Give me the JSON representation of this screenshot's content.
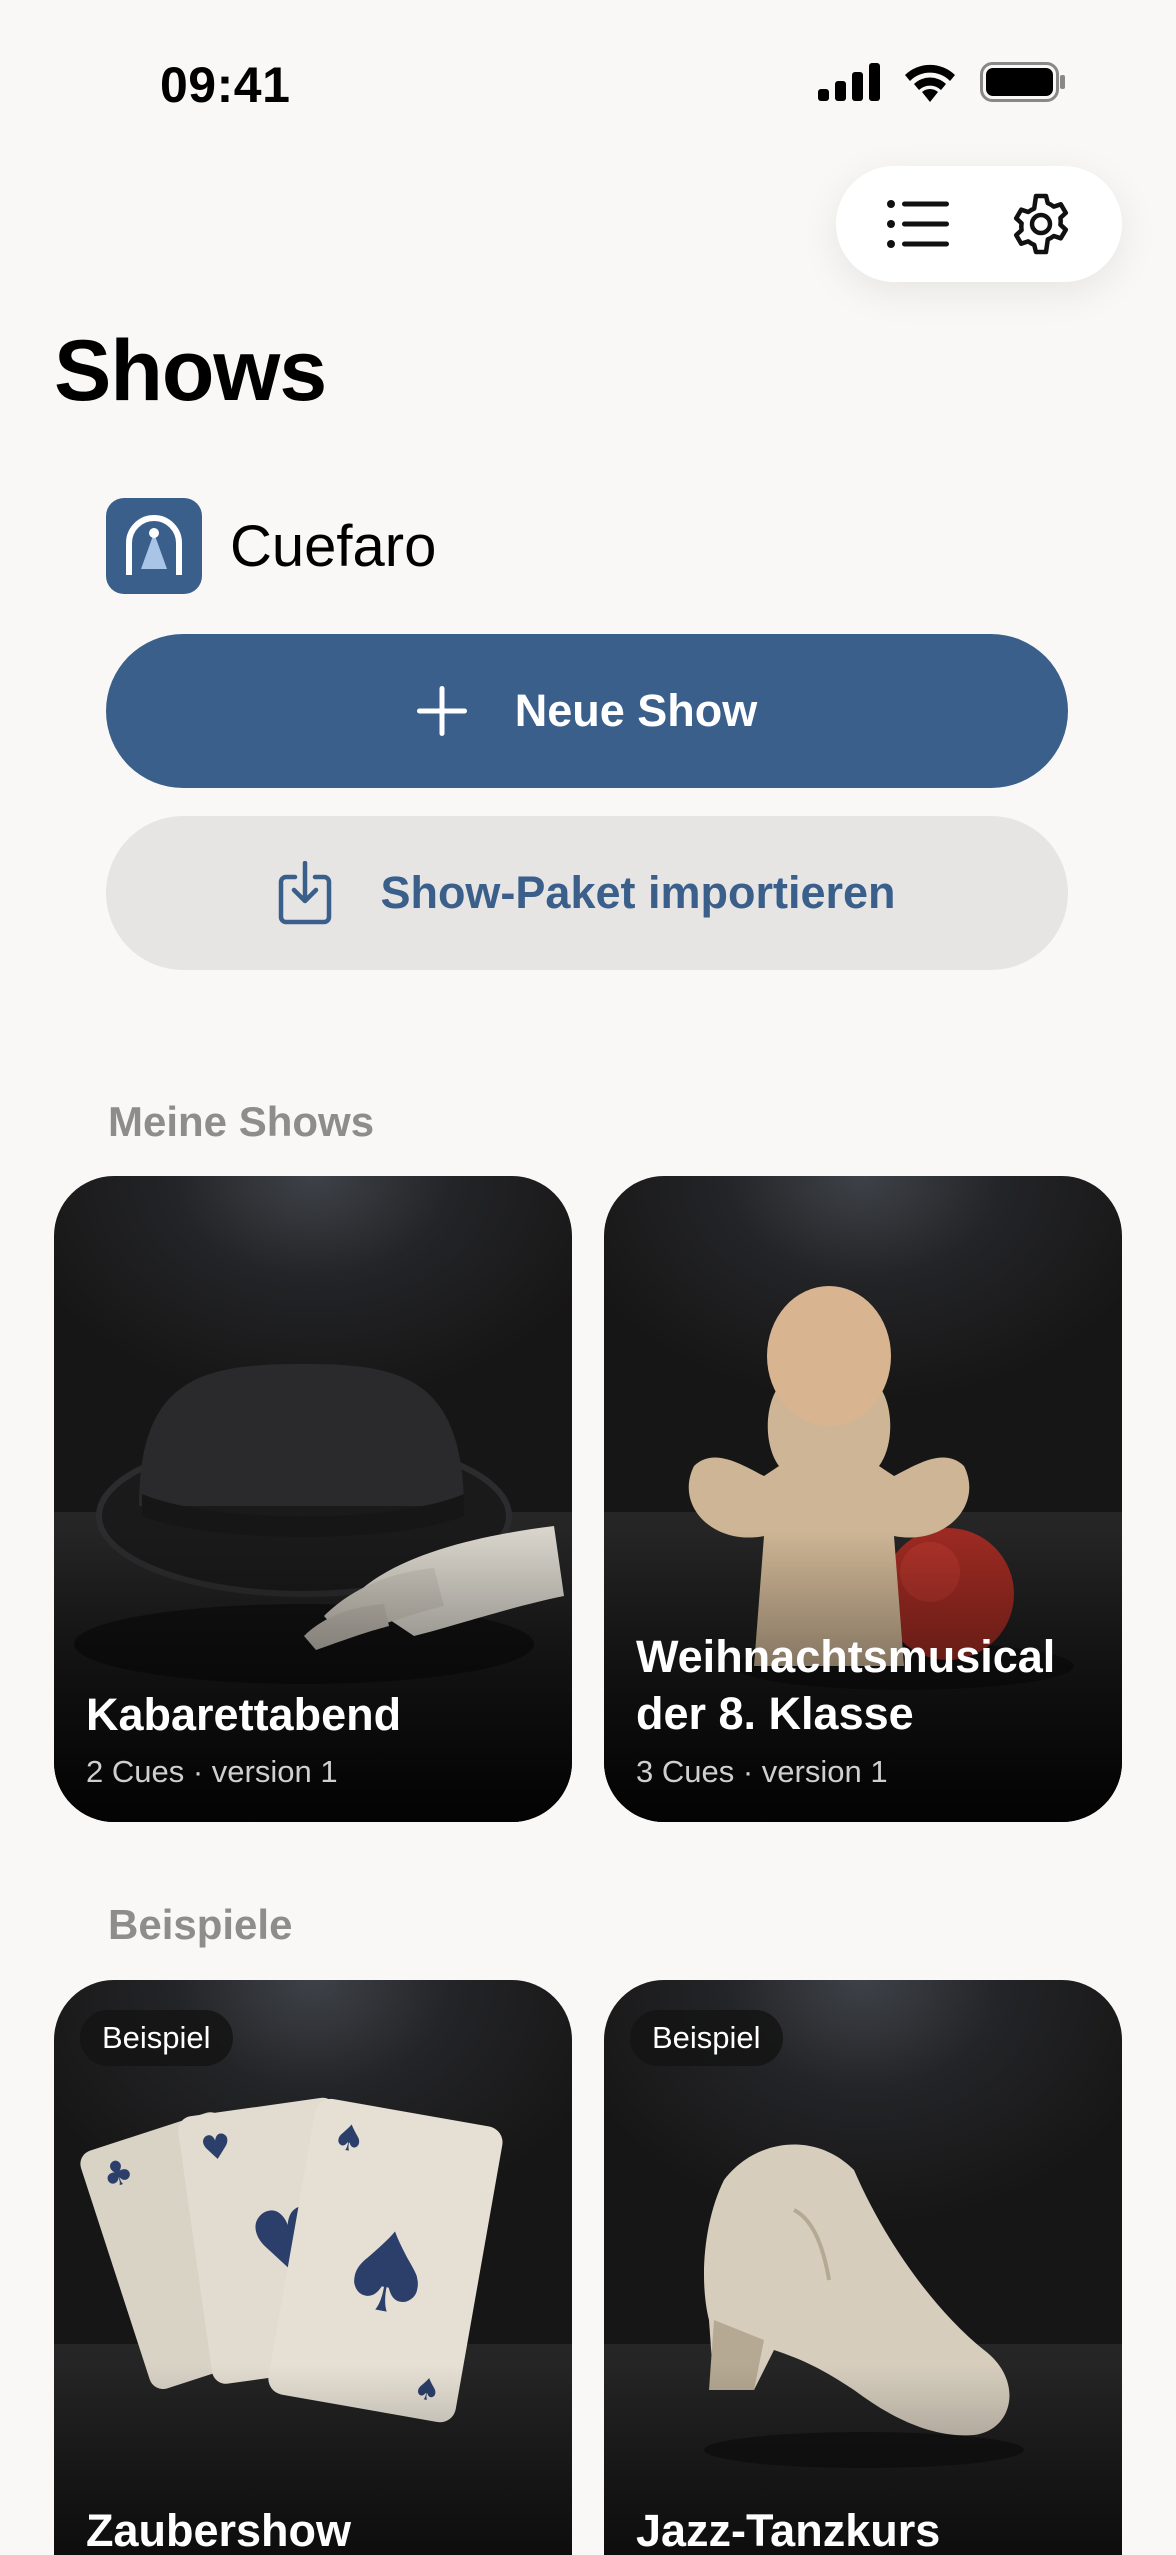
{
  "status": {
    "time": "09:41"
  },
  "page": {
    "title": "Shows"
  },
  "brand": {
    "name": "Cuefaro",
    "color": "#3a5f8b"
  },
  "actions": {
    "new_show": "Neue Show",
    "import_package": "Show-Paket importieren"
  },
  "sections": {
    "my_shows": "Meine Shows",
    "examples": "Beispiele"
  },
  "my_shows": [
    {
      "title": "Kabarettabend",
      "meta": "2 Cues · version 1",
      "image": "bowler-hat-gloves"
    },
    {
      "title": "Weihnachtsmusical der 8. Klasse",
      "meta": "3 Cues · version 1",
      "image": "hand-puppet-ball"
    }
  ],
  "examples": [
    {
      "badge": "Beispiel",
      "title": "Zaubershow",
      "image": "playing-cards"
    },
    {
      "badge": "Beispiel",
      "title": "Jazz-Tanzkurs",
      "image": "jazz-shoe"
    }
  ],
  "icons": {
    "list": "list-icon",
    "settings": "gear-icon",
    "plus": "plus-icon",
    "import": "download-tray-icon"
  }
}
